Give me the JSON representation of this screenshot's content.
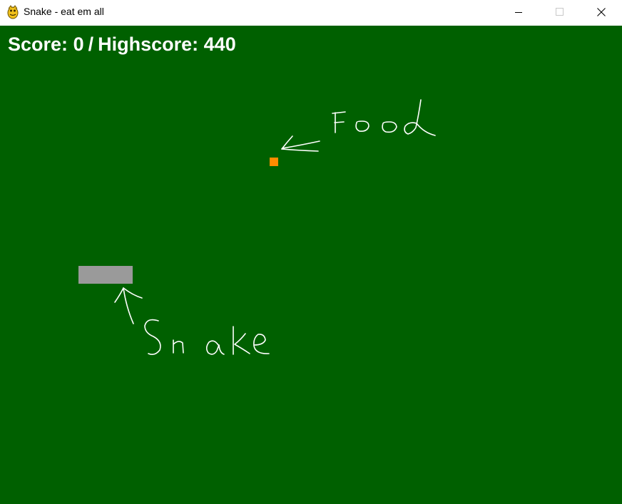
{
  "window": {
    "title": "Snake - eat em all",
    "icon": "pygame-snake-icon",
    "controls": [
      "minimize-icon",
      "maximize-icon",
      "close-icon"
    ]
  },
  "game": {
    "background_color": "#006000",
    "score_label": "Score:",
    "score": "0",
    "separator": "/",
    "highscore_label": "Highscore:",
    "highscore": "440",
    "food_color": "#ff8c00",
    "snake_color": "#9a9a9a",
    "snake_length_segments": 3
  },
  "annotations": {
    "food_label": "Food",
    "snake_label": "Snake",
    "ink_color": "#ffffff"
  }
}
